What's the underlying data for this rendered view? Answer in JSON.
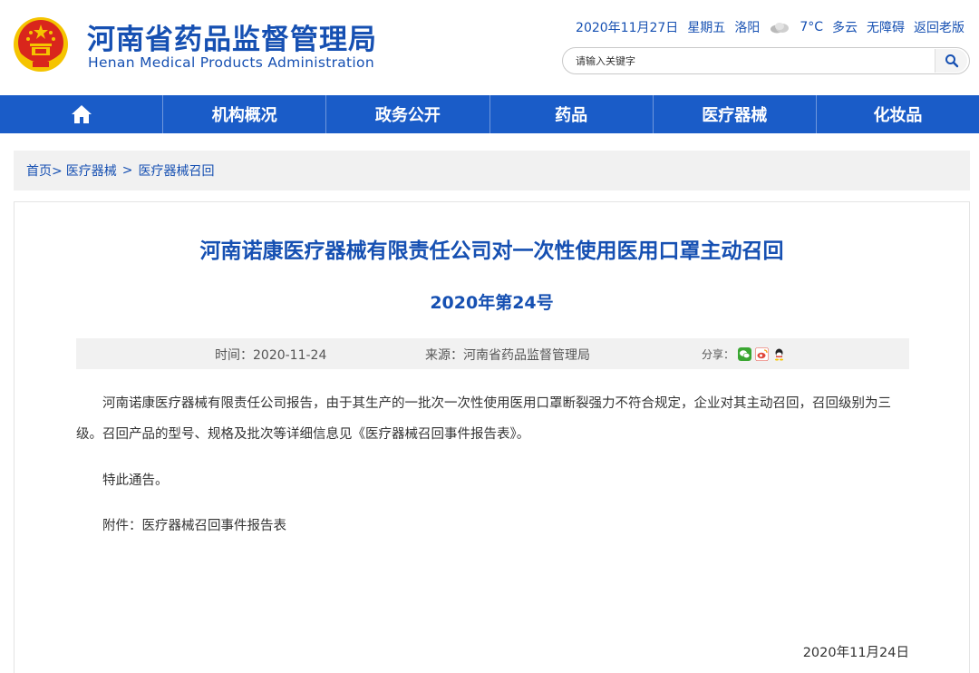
{
  "header": {
    "title_cn": "河南省药品监督管理局",
    "title_en": "Henan Medical Products Administration",
    "date": "2020年11月27日",
    "weekday": "星期五",
    "city": "洛阳",
    "weather_icon": "cloud-icon",
    "temperature": "7°C",
    "weather": "多云",
    "accessibility_label": "无障碍",
    "old_version_label": "返回老版",
    "search_placeholder": "请输入关键字",
    "search_icon": "search-icon"
  },
  "nav": {
    "home_icon": "home-icon",
    "items": [
      "机构概况",
      "政务公开",
      "药品",
      "医疗器械",
      "化妆品"
    ]
  },
  "breadcrumb": {
    "home": "首页>",
    "level1": "医疗器械",
    "sep": ">",
    "level2": "医疗器械召回"
  },
  "article": {
    "title": "河南诺康医疗器械有限责任公司对一次性使用医用口罩主动召回",
    "number": "2020年第24号",
    "time": "时间：2020-11-24",
    "source": "来源：河南省药品监督管理局",
    "share_label": "分享：",
    "share_icons": [
      "wechat-icon",
      "weibo-icon",
      "qq-icon"
    ],
    "paragraph1": "河南诺康医疗器械有限责任公司报告，由于其生产的一批次一次性使用医用口罩断裂强力不符合规定，企业对其主动召回，召回级别为三级。召回产品的型号、规格及批次等详细信息见《医疗器械召回事件报告表》。",
    "paragraph2": "特此通告。",
    "paragraph3": "附件：医疗器械召回事件报告表",
    "sign_date": "2020年11月24日"
  },
  "colors": {
    "brand_blue": "#1650b2",
    "nav_blue": "#1a5cc8",
    "emblem_red": "#d9261c",
    "emblem_gold": "#f5c400"
  }
}
